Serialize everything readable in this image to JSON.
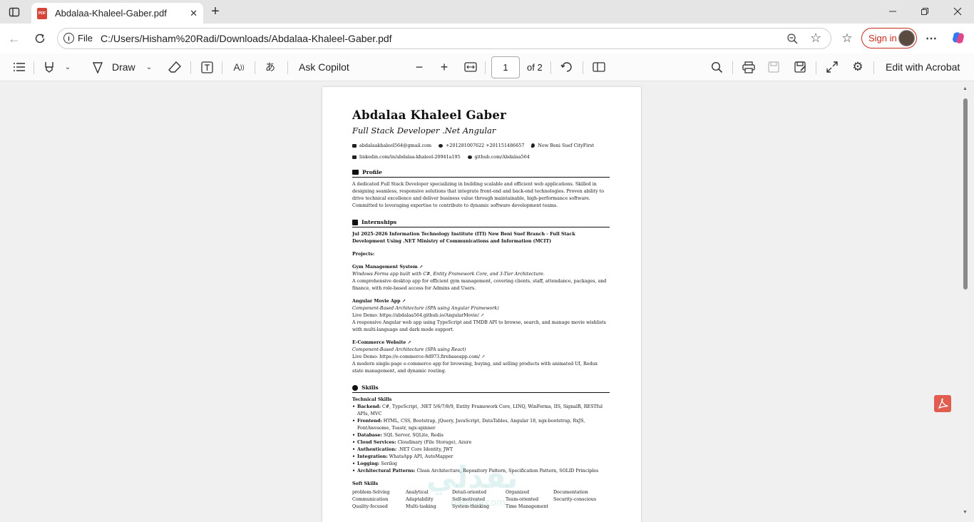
{
  "browser": {
    "tab_title": "Abdalaa-Khaleel-Gaber.pdf",
    "pdf_badge": "PDF",
    "address_prefix": "File",
    "url": "C:/Users/Hisham%20Radi/Downloads/Abdalaa-Khaleel-Gaber.pdf",
    "sign_in_label": "Sign in"
  },
  "toolbar": {
    "draw_label": "Draw",
    "ask_copilot_label": "Ask Copilot",
    "current_page": "1",
    "page_count_label": "of 2",
    "edit_acrobat_label": "Edit with Acrobat"
  },
  "resume": {
    "name": "Abdalaa Khaleel Gaber",
    "title": "Full Stack Developer .Net Angular",
    "email": "abdalaakhaleel564@gmail.com",
    "phone": "+201281007622  +201151486657",
    "location": "New Beni Suef CityFirst",
    "linkedin": "linkedin.com/in/abdalaa-khaleel-20941a195",
    "github": "github.com/Abdalaa564",
    "profile_heading": "Profile",
    "profile_text": "A dedicated Full Stack Developer specializing in building scalable and efficient web applications. Skilled in designing seamless, responsive solutions that integrate front-end and back-end technologies. Proven ability to drive technical excellence and deliver business value through maintainable, high-performance software. Committed to leveraging expertise to contribute to dynamic software development teams.",
    "internships_heading": "Internships",
    "internship_title": "Jul 2025-2026 Information Technology Institute (ITI) New Beni Suef Branch - Full Stack Development Using .NET Ministry of Communications and Information (MCIT)",
    "projects_label": "Projects:",
    "projects": [
      {
        "name": "Gym Management System",
        "sub": "Windows Forms app built with C#, Entity Framework Core, and 3-Tier Architecture.",
        "demo": "",
        "desc": "A comprehensive desktop app for efficient gym management, covering clients, staff, attendance, packages, and finance, with role-based access for Admins and Users."
      },
      {
        "name": "Angular Movie App",
        "sub": "Component-Based Architecture (SPA using Angular Framework)",
        "demo": "Live Demo: https://abdalaa564.github.io/AngularMovie/",
        "desc": "A responsive Angular web app using TypeScript and TMDB API to browse, search, and manage movie wishlists with multi-language and dark mode support."
      },
      {
        "name": "E-Commerce Website",
        "sub": "Component-Based Architecture (SPA using React)",
        "demo": "Live Demo: https://e-commerce-8d973.firebaseapp.com/",
        "desc": "A modern single-page e-commerce app for browsing, buying, and selling products with animated UI, Redux state management, and dynamic routing."
      }
    ],
    "skills_heading": "Skills",
    "technical_label": "Technical Skills",
    "technical": [
      {
        "k": "Backend:",
        "v": "C#, TypeScript, .NET 5/6/7/8/9, Entity Framework Core, LINQ, WinForms, IIS, SignalR, RESTful APIs, MVC"
      },
      {
        "k": "Frontend:",
        "v": "HTML, CSS, Bootstrap, jQuery, JavaScript, DataTables, Angular 18, ngx-bootstrap, RxJS, FontAwesome, Toastr, ngx-spinner"
      },
      {
        "k": "Database:",
        "v": "SQL Server, SQLite, Redis"
      },
      {
        "k": "Cloud Services:",
        "v": "Cloudinary (File Storage), Azure"
      },
      {
        "k": "Authentication:",
        "v": ".NET Core Identity, JWT"
      },
      {
        "k": "Integration:",
        "v": "WhatsApp API, AutoMapper"
      },
      {
        "k": "Logging:",
        "v": "Serilog"
      },
      {
        "k": "Architectural Patterns:",
        "v": "Clean Architecture, Repository Pattern, Specification Pattern, SOLID Principles"
      }
    ],
    "soft_label": "Soft Skills",
    "soft": [
      "problem-Solving",
      "Analytical",
      "Detail-oriented",
      "Organized",
      "Documentation",
      "Communication",
      "Adaptability",
      "Self-motivated",
      "Team-oriented",
      "Security-conscious",
      "Quality-focused",
      "Multi-tasking",
      "System-thinking",
      "Time Management",
      ""
    ]
  },
  "watermark": {
    "main": "نفذلي",
    "sub": "nafezly.com"
  }
}
